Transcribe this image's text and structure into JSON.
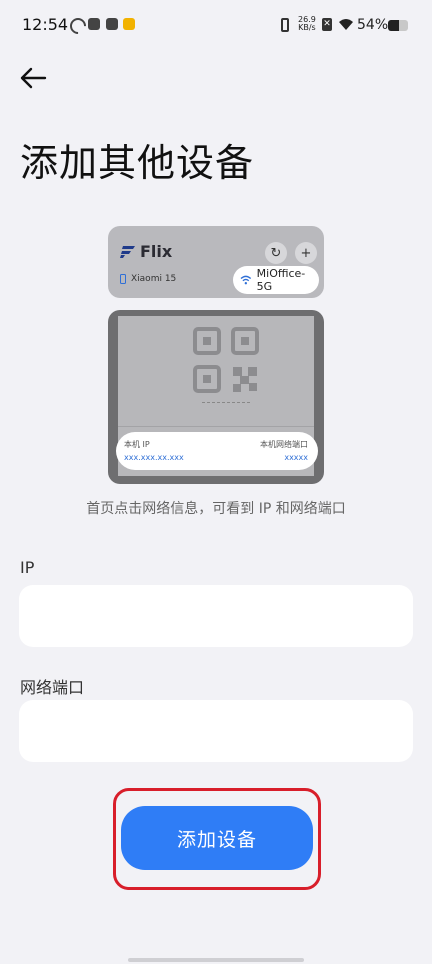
{
  "status_bar": {
    "time": "12:54",
    "net_speed_value": "26.9",
    "net_speed_unit": "KB/s",
    "battery_percent": "54%",
    "battery_level": 0.54
  },
  "header": {
    "back_icon": "arrow-left-icon",
    "title": "添加其他设备"
  },
  "illustration": {
    "app_name": "Flix",
    "device_name": "Xiaomi 15",
    "wifi_name": "MiOffice-5G",
    "ip_label": "本机 IP",
    "ip_value": "xxx.xxx.xx.xxx",
    "port_label": "本机网络端口",
    "port_value": "xxxxx"
  },
  "hint": "首页点击网络信息，可看到 IP 和网络端口",
  "form": {
    "ip_label": "IP",
    "ip_value": "",
    "port_label": "网络端口",
    "port_value": ""
  },
  "actions": {
    "add_device": "添加设备"
  },
  "colors": {
    "accent": "#2f7df6",
    "highlight": "#d81e2a",
    "background": "#f2f2f6"
  }
}
